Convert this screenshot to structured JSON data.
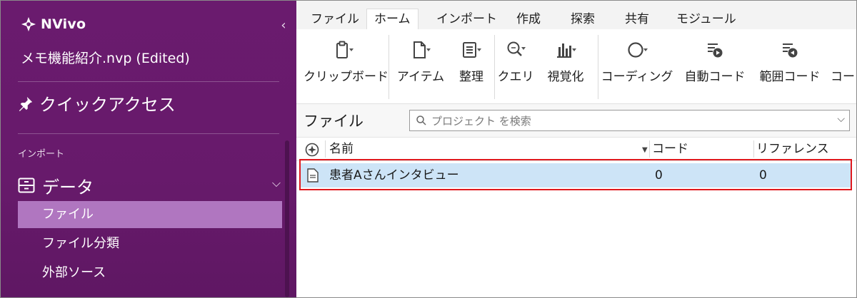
{
  "app": {
    "name": "NVivo",
    "project": "メモ機能紹介.nvp (Edited)"
  },
  "sidebar": {
    "quick_access": "クイックアクセス",
    "section_import": "インポート",
    "data_group": "データ",
    "items": [
      {
        "label": "ファイル",
        "active": true
      },
      {
        "label": "ファイル分類",
        "active": false
      },
      {
        "label": "外部ソース",
        "active": false
      }
    ]
  },
  "tabs": [
    "ファイル",
    "ホーム",
    "インポート",
    "作成",
    "探索",
    "共有",
    "モジュール"
  ],
  "active_tab": "ホーム",
  "ribbon": {
    "clipboard": "クリップボード",
    "item": "アイテム",
    "organize": "整理",
    "query": "クエリ",
    "visualize": "視覚化",
    "coding": "コーディング",
    "auto_code": "自動コード",
    "range_code": "範囲コード",
    "overflow": "コー"
  },
  "panel": {
    "title": "ファイル",
    "search_placeholder": "プロジェクト を検索"
  },
  "table": {
    "headers": {
      "name": "名前",
      "code": "コード",
      "reference": "リファレンス"
    },
    "rows": [
      {
        "name": "患者Aさんインタビュー",
        "code": "0",
        "reference": "0"
      }
    ]
  },
  "colors": {
    "sidebar_bg": "#6a1b6e",
    "active_nav": "#b076c0",
    "row_selected": "#cde4f7",
    "highlight": "#e0191e"
  }
}
